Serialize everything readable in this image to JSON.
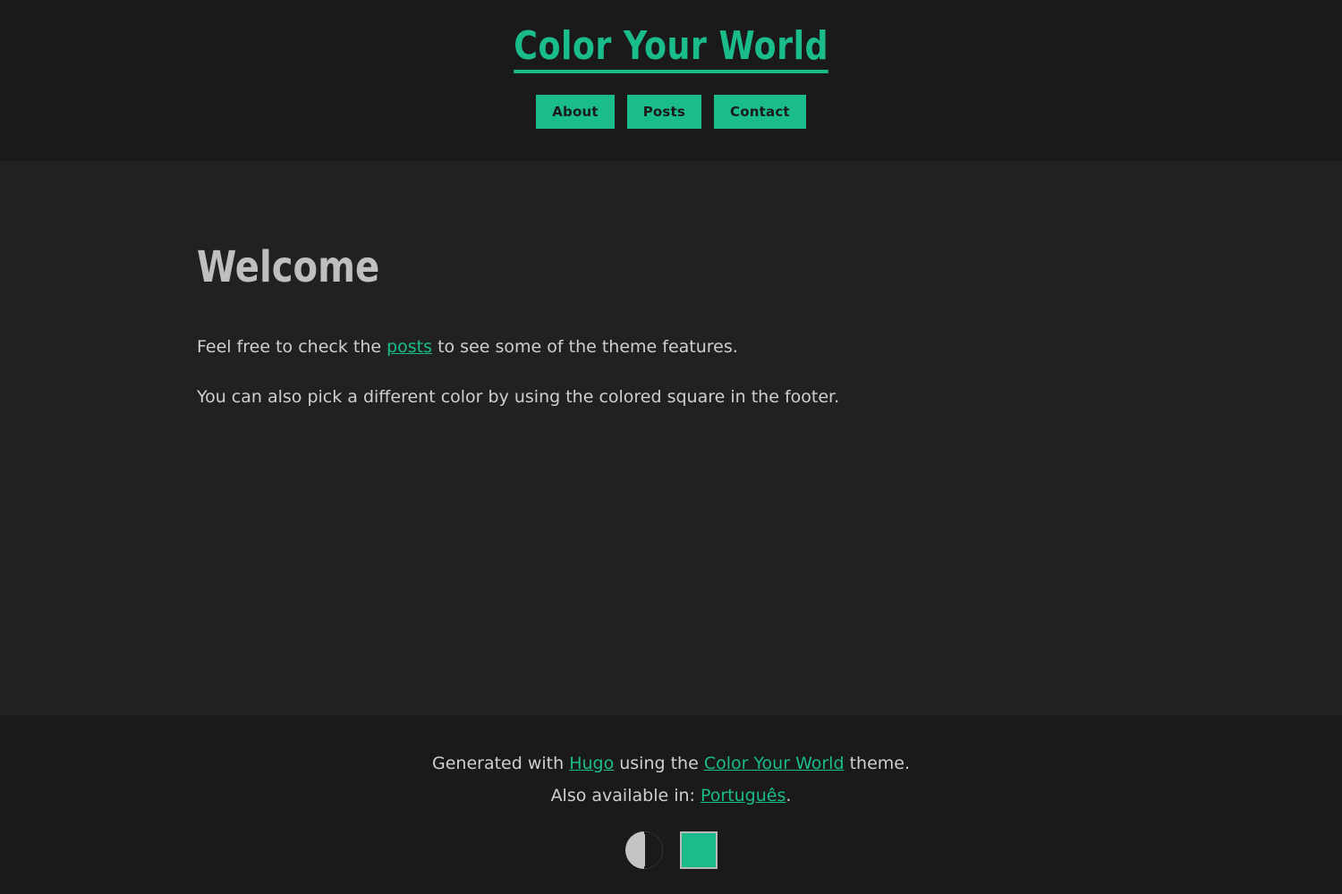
{
  "theme": {
    "accent_color": "#1abc8c",
    "header_bg": "#1a1a1a",
    "main_bg": "#212121",
    "footer_bg": "#1a1a1a",
    "text_color": "#cfcfcf",
    "heading_color": "#bfbfbf"
  },
  "header": {
    "site_title": "Color Your World",
    "nav": [
      {
        "label": "About",
        "name": "nav-about"
      },
      {
        "label": "Posts",
        "name": "nav-posts"
      },
      {
        "label": "Contact",
        "name": "nav-contact"
      }
    ]
  },
  "main": {
    "page_title": "Welcome",
    "paragraph_1": {
      "before_link": "Feel free to check the ",
      "link_text": "posts",
      "after_link": " to see some of the theme features."
    },
    "paragraph_2": {
      "text": "You can also pick a different color by using the colored square in the footer."
    }
  },
  "footer": {
    "line_1": {
      "part_1": "Generated with ",
      "link_1": "Hugo",
      "part_2": " using the ",
      "link_2": "Color Your World",
      "part_3": " theme."
    },
    "line_2": {
      "part_1": "Also available in: ",
      "link_1": "Português",
      "part_2": "."
    },
    "controls": {
      "contrast_toggle_icon": "half-circle-contrast-icon",
      "color_picker_icon": "color-swatch-icon",
      "color_picker_value": "#1abc8c"
    }
  }
}
